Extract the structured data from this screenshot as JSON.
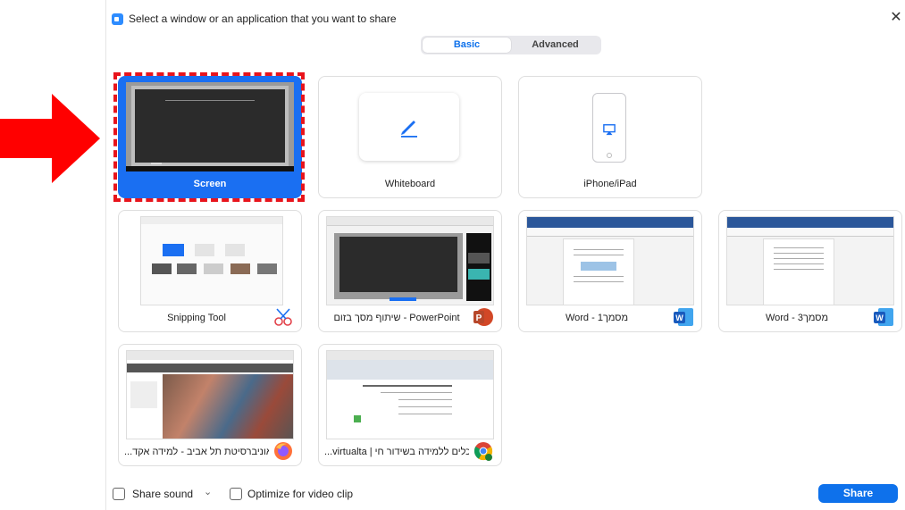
{
  "window": {
    "title": "Select a window or an application that you want to share",
    "close_glyph": "✕"
  },
  "tabs": [
    {
      "label": "Basic",
      "active": true
    },
    {
      "label": "Advanced",
      "active": false
    }
  ],
  "tiles": {
    "screen": {
      "label": "Screen",
      "selected": true
    },
    "whiteboard": {
      "label": "Whiteboard",
      "icon": "pen-icon"
    },
    "iphone": {
      "label": "iPhone/iPad",
      "icon": "airplay-icon"
    },
    "snipping": {
      "label": "Snipping Tool",
      "icon": "scissors-icon"
    },
    "powerpoint": {
      "label": "שיתוף מסך בזום - PowerPoint",
      "icon": "powerpoint-icon",
      "badge": "P"
    },
    "word1": {
      "label": "Word - מסמך1",
      "icon": "word-icon",
      "badge": "W"
    },
    "word3": {
      "label": "Word - מסמך3",
      "icon": "word-icon",
      "badge": "W"
    },
    "firefox": {
      "label": "...אוניברסיטת תל אביב - למידה אקד",
      "icon": "firefox-icon"
    },
    "chrome": {
      "label": "...virtualta | כלים ללמידה בשידור חי",
      "icon": "chrome-icon"
    }
  },
  "bottom": {
    "share_sound": "Share sound",
    "optimize": "Optimize for video clip",
    "share_button": "Share"
  },
  "colors": {
    "accent": "#0e71eb",
    "selected_tile": "#1a6ff2",
    "highlight_red": "#e8141c"
  }
}
